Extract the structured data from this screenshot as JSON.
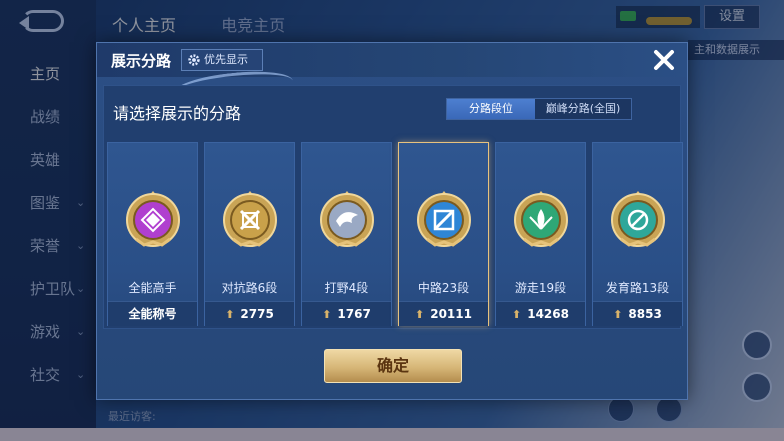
{
  "background": {
    "nav_items": [
      {
        "label": "主页",
        "active": true,
        "caret": false
      },
      {
        "label": "战绩",
        "active": false,
        "caret": false
      },
      {
        "label": "英雄",
        "active": false,
        "caret": false
      },
      {
        "label": "图鉴",
        "active": false,
        "caret": true
      },
      {
        "label": "荣誉",
        "active": false,
        "caret": true
      },
      {
        "label": "护卫队",
        "active": false,
        "caret": true
      },
      {
        "label": "游戏",
        "active": false,
        "caret": true
      },
      {
        "label": "社交",
        "active": false,
        "caret": true
      }
    ],
    "top_tabs": [
      "个人主页",
      "电竞主页"
    ],
    "settings_label": "设置",
    "right_banner": "主和数据展示",
    "visitors_label": "最近访客:"
  },
  "modal": {
    "title": "展示分路",
    "priority_label": "优先显示",
    "heading": "请选择展示的分路",
    "toggle": {
      "options": [
        "分路段位",
        "巅峰分路(全国)"
      ],
      "active_index": 0
    },
    "confirm_label": "确定",
    "cards": [
      {
        "label": "全能高手",
        "footer": "全能称号",
        "has_arrow": false,
        "selected": false,
        "badge_color": "#b03fcf",
        "badge_icon": "all-round-icon"
      },
      {
        "label": "对抗路6段",
        "footer": "2775",
        "has_arrow": true,
        "selected": false,
        "badge_color": "#c9a14a",
        "badge_icon": "crossed-swords-icon"
      },
      {
        "label": "打野4段",
        "footer": "1767",
        "has_arrow": true,
        "selected": false,
        "badge_color": "#9aa9c4",
        "badge_icon": "jungle-dragon-icon"
      },
      {
        "label": "中路23段",
        "footer": "20111",
        "has_arrow": true,
        "selected": true,
        "badge_color": "#2f86d6",
        "badge_icon": "mid-lane-icon"
      },
      {
        "label": "游走19段",
        "footer": "14268",
        "has_arrow": true,
        "selected": false,
        "badge_color": "#2fa776",
        "badge_icon": "support-icon"
      },
      {
        "label": "发育路13段",
        "footer": "8853",
        "has_arrow": true,
        "selected": false,
        "badge_color": "#2fa79a",
        "badge_icon": "marksman-icon"
      }
    ]
  }
}
